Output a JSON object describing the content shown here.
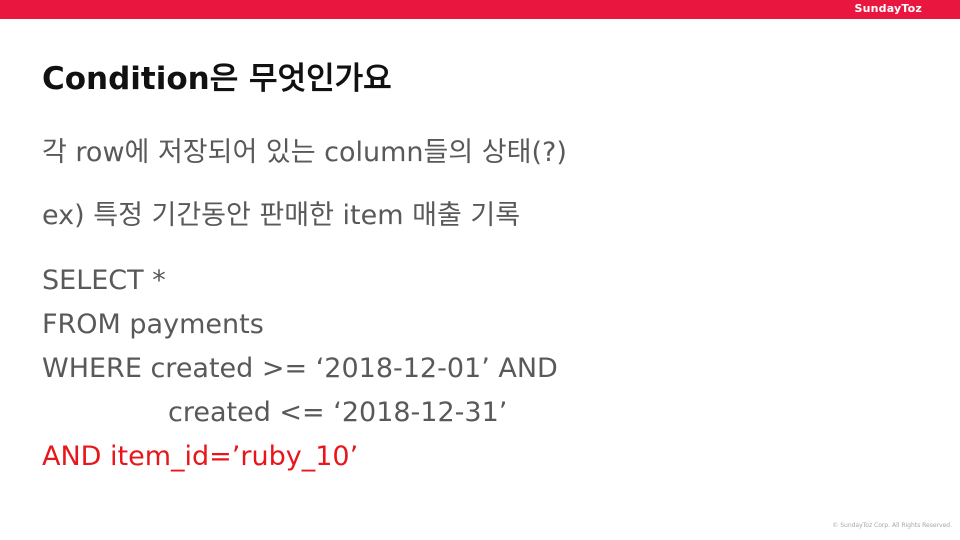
{
  "brand": {
    "logo_text": "SundayToz",
    "accent_color": "#e9173f"
  },
  "slide": {
    "title": "Condition은 무엇인가요",
    "lines": [
      "각 row에 저장되어 있는 column들의 상태(?)",
      "ex) 특정 기간동안 판매한 item 매출 기록"
    ],
    "code": [
      "SELECT *",
      "FROM payments",
      "WHERE created >= ‘2018-12-01’ AND",
      "created <= ‘2018-12-31’",
      "AND item_id=’ruby_10’"
    ],
    "highlight_color": "#e8161a"
  },
  "footer": {
    "copyright": "© SundayToz Corp. All Rights Reserved."
  }
}
